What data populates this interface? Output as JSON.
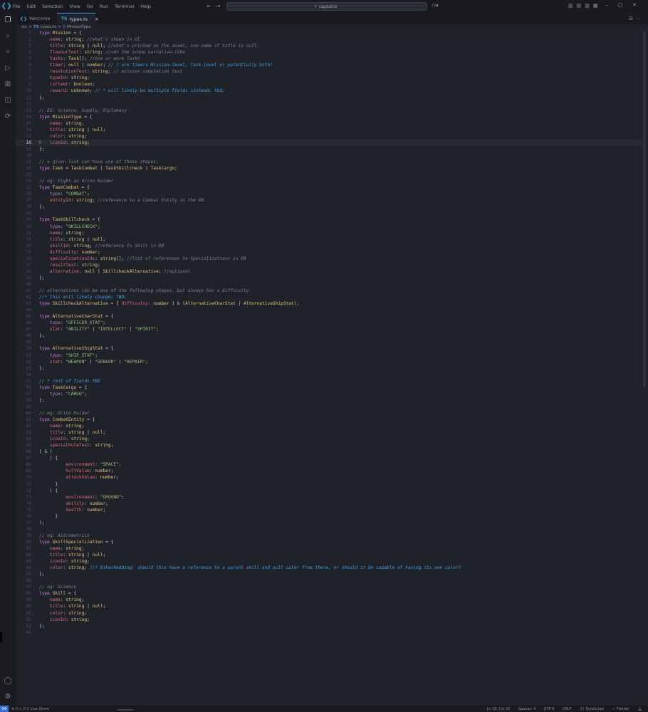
{
  "titlebar": {
    "menu": [
      "File",
      "Edit",
      "Selection",
      "View",
      "Go",
      "Run",
      "Terminal",
      "Help"
    ],
    "search_text": "captains",
    "search_icon": "search-icon",
    "copilot_icon": "copilot-icon"
  },
  "tabs": [
    {
      "label": "Welcome",
      "icon": "vscode-icon"
    },
    {
      "label": "types.ts",
      "icon": "ts-icon",
      "close": "×"
    }
  ],
  "breadcrumb": {
    "folder": "src",
    "sep": ">",
    "file": "types.ts",
    "sep2": ">",
    "symbol": "MissionType"
  },
  "editor": {
    "current_line": 18,
    "lines": [
      "type Mission = {",
      "    name: string; //what's shown in UI",
      "    title: string | null; //what's printed on the asset, use name if title is null.",
      "    flavourText: string; //set the scene narrative-like",
      "    tasks: Task[]; //one or more Tasks",
      "    timer: null | number; // ? are timers Mission-level, Task-level or potentially both?",
      "    resolutionText: string; // mission completion text",
      "    typeId: string;",
      "    isFleet: boolean;",
      "    reward: unknown; // * will likely be multiple fields instead; tbd;",
      "};",
      "",
      "// EG: Science, Supply, Diplomacy",
      "type MissionType = {",
      "    name: string;",
      "    title: string | null;",
      "    color: string;",
      "    iconId: string;",
      "};",
      "",
      "// a given Task can have one of these shapes:",
      "type Task = TaskCombat | TaskSkillcheck | TaskCargo;",
      "",
      "// eg: Fight an Orion Raider",
      "type TaskCombat = {",
      "    type: \"COMBAT\";",
      "    entityId: string; //reference to a Combat Entity in the DB.",
      "};",
      "",
      "type TaskSkillcheck = {",
      "    type: \"SKILLCHECK\";",
      "    name: string;",
      "    title: string | null;",
      "    skillId: string; //reference to Skill in DB",
      "    difficulty: number;",
      "    specializationIds: string[]; //list of references to Specializations in DB",
      "    resultText: string;",
      "    alternative: null | SkillcheckAlternative; //optional",
      "};",
      "",
      "// alternatives can be one of the following shapes, but always has a difficulty",
      "//* this will likely change; TBD;",
      "type SkillcheckAlternative = { difficulty: number } & (AlternativeCharStat | AlternativeShipStat);",
      "",
      "type AlternativeCharStat = {",
      "    type: \"OFFICER_STAT\";",
      "    stat: \"ABILITY\" | \"INTELLECT\" | \"SPIRIT\";",
      "};",
      "",
      "type AlternativeShipStat = {",
      "    type: \"SHIP_STAT\";",
      "    stat: \"WEAPON\" | \"SENSOR\" | \"REPAIR\";",
      "};",
      "",
      "// * rest of fields TBD",
      "type TaskCargo = {",
      "    type: \"CARGO\";",
      "};",
      "",
      "// eg: Orion Raider",
      "type CombatEntity = {",
      "    name: string;",
      "    title: string | null;",
      "    iconId: string;",
      "    specialRuleText: string;",
      "} & (",
      "    | {",
      "          environment: \"SPACE\";",
      "          hullValue: number;",
      "          attackValue: number;",
      "      }",
      "    | {",
      "          environment: \"GROUND\";",
      "          ability: number;",
      "          health: number;",
      "      }",
      ");",
      "",
      "// eg: Astrometrics",
      "type SkillSpecialization = {",
      "    name: string;",
      "    title: string | null;",
      "    iconId: string;",
      "    color: string; //? Bikeshedding: should this have a reference to a parent skill and pull color from there, or should it be capable of having its own color?",
      "};",
      "",
      "// eg: Science",
      "type Skill = {",
      "    name: string;",
      "    title: string | null;",
      "    color: string;",
      "    iconId: string;",
      "};",
      ""
    ]
  },
  "statusbar": {
    "left": "⊗ 0 ⚠ 0  ⚲ Live Share",
    "position": "Ln 18, Col 20",
    "spaces": "Spaces: 4",
    "encoding": "UTF-8",
    "eol": "CRLF",
    "language": "{} TypeScript",
    "prettier": "✓ Prettier"
  },
  "colors": {
    "keyword": "#c678dd",
    "type_name": "#e5c07b",
    "property": "#e06c75",
    "string": "#98c379",
    "comment": "#7f848e",
    "todo_comment": "#3fa0f0",
    "punct": "#c8ccd4",
    "accent": "#3c9ee6"
  }
}
